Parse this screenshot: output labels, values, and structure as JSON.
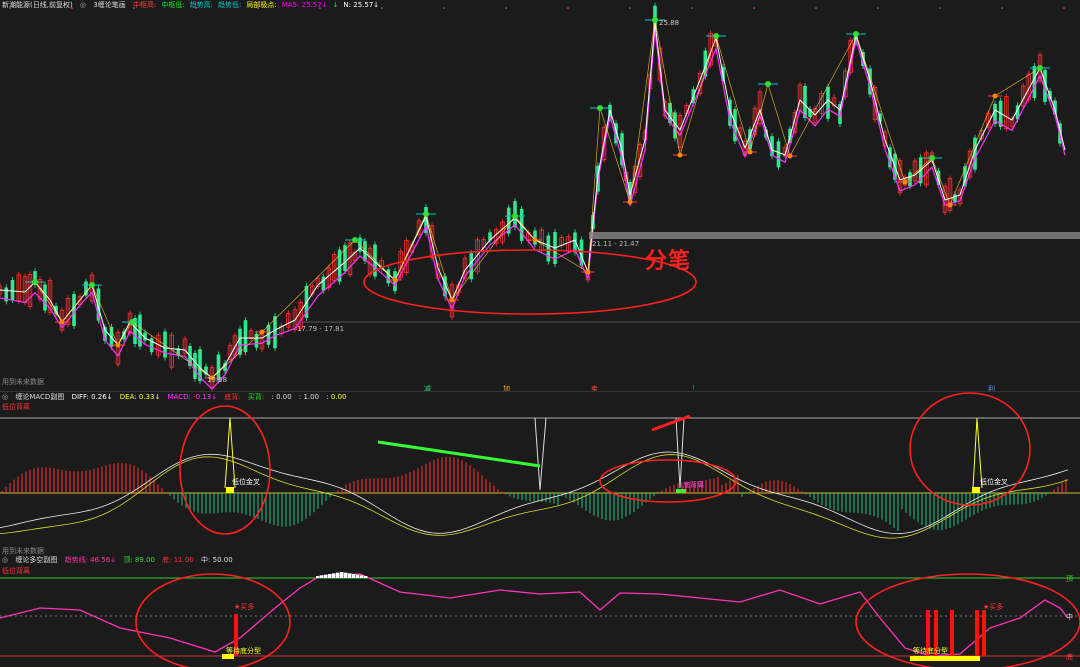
{
  "main_header": {
    "title": "新潮能源(日线,前复权)",
    "indicator": "3缠论笔画",
    "items": [
      {
        "label": "中枢高:",
        "color": "#ff4040"
      },
      {
        "label": "中枢低:",
        "color": "#33dd33"
      },
      {
        "label": "趋势高:",
        "color": "#00c8c8"
      },
      {
        "label": "趋势低:",
        "color": "#00c8c8"
      },
      {
        "label": "局部极点:",
        "color": "#ffff00"
      },
      {
        "label": "MA5: 25.57↓",
        "color": "#ff00ff"
      },
      {
        "label": "↓",
        "color": "#33dd33"
      },
      {
        "label": "N: 25.57↓",
        "color": "#ffffff"
      }
    ]
  },
  "main_chart": {
    "peak_label": "25.88",
    "low_label": "15.58",
    "range_label_1": "17.79 - 17.81",
    "range_label_2": "21.11 - 21.47",
    "annotation": "分笔",
    "future_label": "用到未来数据",
    "signal_marks": [
      {
        "text": "减",
        "color": "#33dd88"
      },
      {
        "text": "加",
        "color": "#ffaa33"
      },
      {
        "text": "卖",
        "color": "#ff4040"
      },
      {
        "text": "!",
        "color": "#ff4040"
      },
      {
        "text": "利",
        "color": "#5599ff"
      }
    ],
    "colors": {
      "up": "#ff3030",
      "down": "#30e890",
      "ma": "#ff30ff",
      "price": "#ffffff",
      "bi": "#ffcc33"
    }
  },
  "macd_header": {
    "name": "缠论MACD副图",
    "diff": "DIFF: 0.26↓",
    "dea": "DEA: 0.33↓",
    "macd": "MACD: -0.13↓",
    "beili": "底背:",
    "yes": "买背:",
    "val1": ": 0.00",
    "val2": ": 1.00",
    "val3": ": 0.00",
    "sub": "低位背离"
  },
  "macd_chart": {
    "label_gold_1": "低位金叉",
    "label_gold_2": "低位金叉",
    "label_beili": "底背离",
    "future_label": "用到未来数据"
  },
  "bs_header": {
    "name": "缠论多空副图",
    "trend": "趋势线: 46.56↓",
    "top": "顶: 89.00",
    "bottom": "底: 11.00",
    "mid": "中: 50.00",
    "sub": "低位背离"
  },
  "bs_chart": {
    "label_buy_1": "★买多",
    "label_buy_2": "★买多",
    "label_wait_1": "等待底分型",
    "label_wait_2": "等待底分型",
    "axis_top": "顶",
    "axis_mid": "中",
    "axis_bottom": "底"
  }
}
